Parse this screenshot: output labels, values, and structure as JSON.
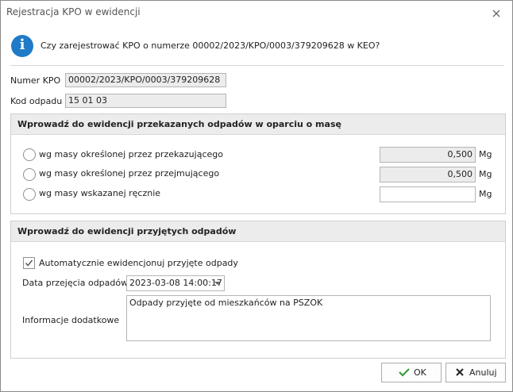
{
  "window": {
    "title": "Rejestracja KPO w ewidencji"
  },
  "question": "Czy zarejestrować KPO o numerze 00002/2023/KPO/0003/379209628 w KEO?",
  "fields": {
    "numer_label": "Numer KPO",
    "numer_value": "00002/2023/KPO/0003/379209628",
    "kod_label": "Kod odpadu",
    "kod_value": "15 01 03"
  },
  "group1": {
    "title": "Wprowadź do ewidencji przekazanych odpadów w oparciu o masę",
    "options": [
      {
        "label": "wg masy określonej przez przekazującego",
        "value": "0,500",
        "unit": "Mg"
      },
      {
        "label": "wg masy określonej przez przejmującego",
        "value": "0,500",
        "unit": "Mg"
      },
      {
        "label": "wg masy wskazanej ręcznie",
        "value": "",
        "unit": "Mg"
      }
    ]
  },
  "group2": {
    "title": "Wprowadź do ewidencji przyjętych odpadów",
    "auto_label": "Automatycznie ewidencjonuj przyjęte odpady",
    "date_label": "Data przejęcia odpadów",
    "date_value": "2023-03-08 14:00:17",
    "info_label": "Informacje dodatkowe",
    "info_value": "Odpady przyjęte od mieszkańców na PSZOK"
  },
  "buttons": {
    "ok": "OK",
    "cancel": "Anuluj"
  },
  "colors": {
    "info": "#1f7bc7",
    "ok_check": "#3a9c3a",
    "group_header": "#ececec"
  }
}
